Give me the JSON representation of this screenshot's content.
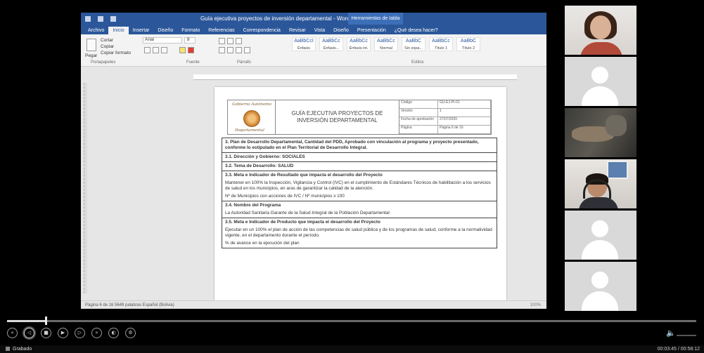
{
  "word": {
    "title": "Guía ejecutiva proyectos de inversión departamental - Word",
    "contextual_tab": "Herramientas de tabla",
    "tabs": [
      "Archivo",
      "Inicio",
      "Insertar",
      "Diseño",
      "Formato",
      "Referencias",
      "Correspondencia",
      "Revisar",
      "Vista",
      "Diseño",
      "Presentación",
      "¿Qué desea hacer?"
    ],
    "active_tab_index": 1,
    "ribbon": {
      "clipboard_label": "Portapapeles",
      "font_label": "Fuente",
      "paragraph_label": "Párrafo",
      "styles_label": "Estilos",
      "paste": "Pegar",
      "cut": "Cortar",
      "copy": "Copiar",
      "format_painter": "Copiar formato",
      "font_name": "Arial",
      "font_size": "8",
      "styles": [
        {
          "sample": "AaBbCcI",
          "name": "Énfasis"
        },
        {
          "sample": "AaBbCc",
          "name": "Énfasis..."
        },
        {
          "sample": "AaBbCc",
          "name": "Énfasis int."
        },
        {
          "sample": "AaBbCc",
          "name": "Normal"
        },
        {
          "sample": "AaBbC",
          "name": "Sin espa..."
        },
        {
          "sample": "AaBbCc",
          "name": "Título 1"
        },
        {
          "sample": "AaBbC",
          "name": "Título 2"
        }
      ]
    },
    "statusbar": {
      "left": "Página 6 de 16    5649 palabras    Español (Bolivia)",
      "right": "100%"
    }
  },
  "document": {
    "header": {
      "logo_top": "Gobierno Autónomo",
      "logo_bottom": "Departamental",
      "title": "GUÍA EJECUTIVA PROYECTOS DE INVERSIÓN DEPARTAMENTAL",
      "meta": [
        [
          "Código",
          "GU-EJ-PI-01"
        ],
        [
          "Versión",
          "1"
        ],
        [
          "Fecha de aprobación",
          "27/07/2020"
        ],
        [
          "Página",
          "Página 6 de 16"
        ]
      ]
    },
    "sections": [
      {
        "heading": "3.  Plan de Desarrollo Departamental, Cantidad del PDD, Aprobado con vinculación al programa y proyecto presentado, conforme lo estipulado en el Plan Territorial de Desarrollo Integral.",
        "text": ""
      },
      {
        "heading": "3.1. Dirección y Gobierno: SOCIALES",
        "text": ""
      },
      {
        "heading": "3.2. Tema de Desarrollo: SALUD",
        "text": ""
      },
      {
        "heading": "3.3. Meta e Indicador de Resultado que impacta el desarrollo del Proyecto",
        "text": "Mantener en 100% la Inspección, Vigilancia y Control (IVC) en el cumplimiento de Estándares Técnicos de habilitación a los servicios de salud en los municipios, en aras de garantizar la calidad de la atención.",
        "text2": "Nº de Municipios con acciones de IVC / Nº municipios x 100"
      },
      {
        "heading": "3.4. Nombre del Programa",
        "text": "La Autoridad Sanitaria Garante de la Salud Integral de la Población Departamental"
      },
      {
        "heading": "3.5. Meta e Indicador de Producto que impacta el desarrollo del Proyecto",
        "text": "Ejecutar en un 100% el plan de acción de las competencias de salud pública y de los programas de salud, conforme a la normatividad vigente, en el departamento durante el período.",
        "text2": "% de avance en la ejecución del plan"
      }
    ]
  },
  "participants": [
    {
      "kind": "camera",
      "desc": "participant-1"
    },
    {
      "kind": "placeholder"
    },
    {
      "kind": "camera",
      "desc": "participant-3"
    },
    {
      "kind": "camera",
      "desc": "participant-4"
    },
    {
      "kind": "placeholder"
    },
    {
      "kind": "placeholder"
    }
  ],
  "player": {
    "progress": 0.055,
    "controls": [
      "rewind",
      "previous",
      "stop",
      "play",
      "next",
      "fast-forward",
      "slow",
      "settings"
    ],
    "selected_control_index": 1
  },
  "taskline": {
    "label": "Grabado",
    "time": "00:03:45 / 00:58:12"
  },
  "colors": {
    "word_blue": "#2b579a",
    "background": "#000000",
    "placeholder_tile": "#d9d9d9"
  }
}
